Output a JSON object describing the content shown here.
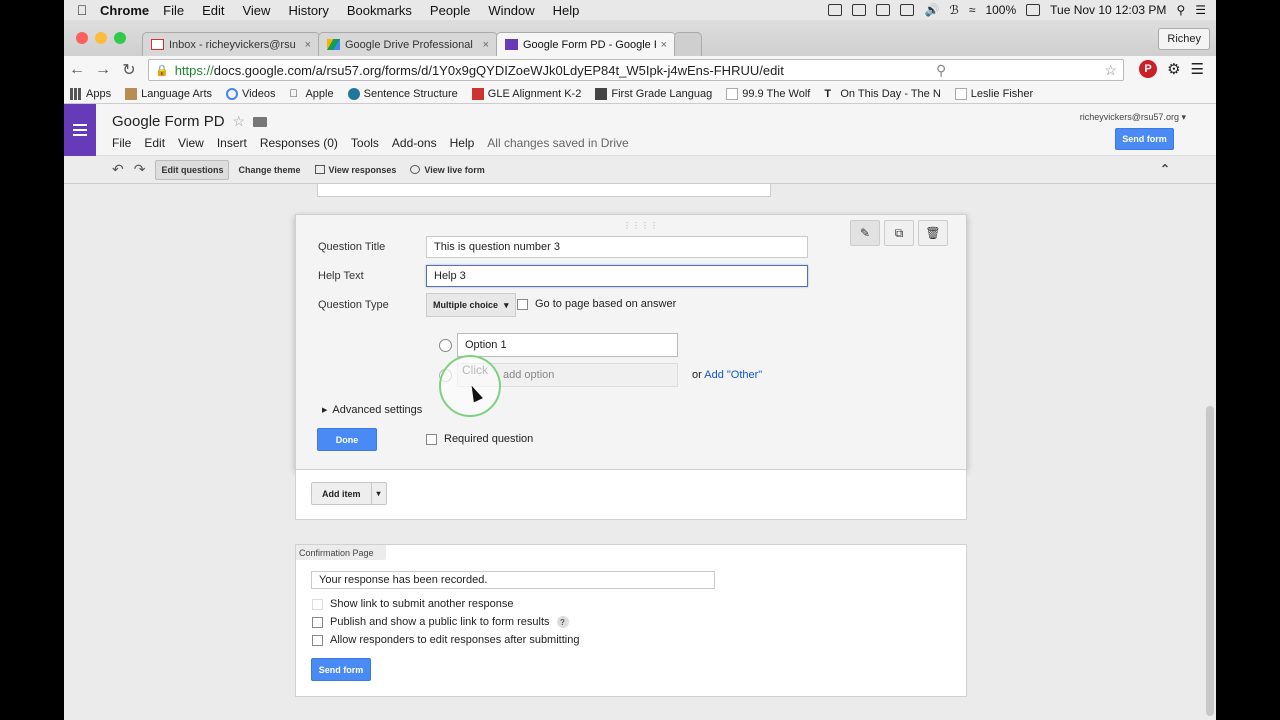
{
  "menubar": {
    "app": "Chrome",
    "items": [
      "File",
      "Edit",
      "View",
      "History",
      "Bookmarks",
      "People",
      "Window",
      "Help"
    ],
    "battery": "100%",
    "clock": "Tue Nov 10  12:03 PM"
  },
  "tabs": [
    {
      "title": "Inbox - richeyvickers@rsu",
      "icon": "gmail-icon"
    },
    {
      "title": "Google Drive Professional",
      "icon": "drive-icon"
    },
    {
      "title": "Google Form PD - Google F",
      "icon": "forms-icon",
      "active": true
    }
  ],
  "profile": "Richey",
  "url": {
    "scheme": "https://",
    "rest": "docs.google.com/a/rsu57.org/forms/d/1Y0x9gQYDIZoeWJk0LdyEP84t_W5Ipk-j4wEns-FHRUU/edit"
  },
  "bookmarks": [
    "Apps",
    "Language Arts",
    "Videos",
    "Apple",
    "Sentence Structure",
    "GLE Alignment K-2",
    "First Grade Languag",
    "99.9 The Wolf",
    "On This Day - The N",
    "Leslie Fisher"
  ],
  "doc": {
    "title": "Google Form PD",
    "menu": [
      "File",
      "Edit",
      "View",
      "Insert",
      "Responses (0)",
      "Tools",
      "Add-ons",
      "Help"
    ],
    "saved_status": "All changes saved in Drive",
    "account": "richeyvickers@rsu57.org",
    "send_form": "Send form"
  },
  "edit_toolbar": {
    "edit_questions": "Edit questions",
    "change_theme": "Change theme",
    "view_responses": "View responses",
    "view_live_form": "View live form"
  },
  "question": {
    "title_label": "Question Title",
    "title_value": "This is question number 3",
    "help_label": "Help Text",
    "help_value": "Help 3",
    "type_label": "Question Type",
    "type_value": "Multiple choice",
    "go_to_page": "Go to page based on answer",
    "option1": "Option 1",
    "add_option_hint": "Click",
    "add_option": "add option",
    "or_text": "or",
    "add_other": "Add \"Other\"",
    "advanced": "Advanced settings",
    "done": "Done",
    "required": "Required question"
  },
  "add_item": "Add item",
  "confirmation": {
    "tab": "Confirmation Page",
    "message": "Your response has been recorded.",
    "options": [
      "Show link to submit another response",
      "Publish and show a public link to form results",
      "Allow responders to edit responses after submitting"
    ],
    "send_form": "Send form"
  },
  "colors": {
    "forms_purple": "#673ab7",
    "button_blue": "#4a8af4",
    "link_blue": "#1155cc"
  }
}
